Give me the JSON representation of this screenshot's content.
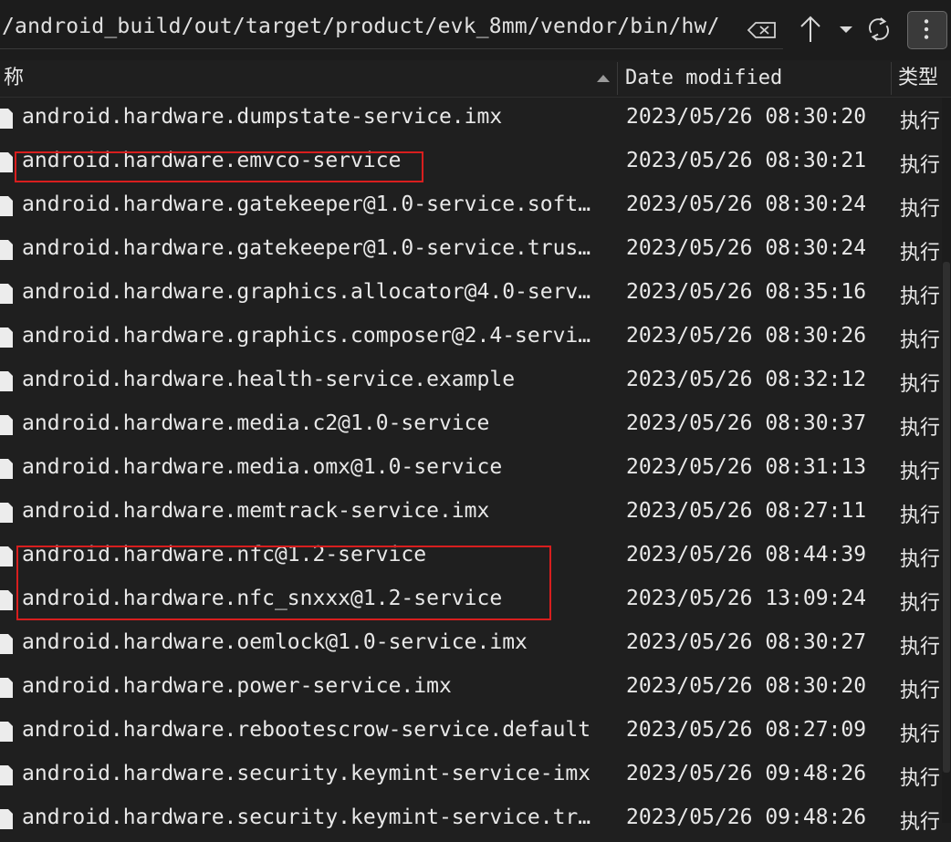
{
  "toolbar": {
    "path": "/android_build/out/target/product/evk_8mm/vendor/bin/hw/",
    "icons": [
      "backspace-icon",
      "up-arrow-icon",
      "chevron-down-icon",
      "refresh-icon",
      "more-vertical-icon"
    ]
  },
  "header": {
    "name": "称",
    "date": "Date modified",
    "type": "类型"
  },
  "files": [
    {
      "name": "android.hardware.dumpstate-service.imx",
      "date": "2023/05/26 08:30:20",
      "type": "执行"
    },
    {
      "name": "android.hardware.emvco-service",
      "date": "2023/05/26 08:30:21",
      "type": "执行"
    },
    {
      "name": "android.hardware.gatekeeper@1.0-service.soft…",
      "date": "2023/05/26 08:30:24",
      "type": "执行"
    },
    {
      "name": "android.hardware.gatekeeper@1.0-service.trus…",
      "date": "2023/05/26 08:30:24",
      "type": "执行"
    },
    {
      "name": "android.hardware.graphics.allocator@4.0-serv…",
      "date": "2023/05/26 08:35:16",
      "type": "执行"
    },
    {
      "name": "android.hardware.graphics.composer@2.4-servi…",
      "date": "2023/05/26 08:30:26",
      "type": "执行"
    },
    {
      "name": "android.hardware.health-service.example",
      "date": "2023/05/26 08:32:12",
      "type": "执行"
    },
    {
      "name": "android.hardware.media.c2@1.0-service",
      "date": "2023/05/26 08:30:37",
      "type": "执行"
    },
    {
      "name": "android.hardware.media.omx@1.0-service",
      "date": "2023/05/26 08:31:13",
      "type": "执行"
    },
    {
      "name": "android.hardware.memtrack-service.imx",
      "date": "2023/05/26 08:27:11",
      "type": "执行"
    },
    {
      "name": "android.hardware.nfc@1.2-service",
      "date": "2023/05/26 08:44:39",
      "type": "执行"
    },
    {
      "name": "android.hardware.nfc_snxxx@1.2-service",
      "date": "2023/05/26 13:09:24",
      "type": "执行"
    },
    {
      "name": "android.hardware.oemlock@1.0-service.imx",
      "date": "2023/05/26 08:30:27",
      "type": "执行"
    },
    {
      "name": "android.hardware.power-service.imx",
      "date": "2023/05/26 08:30:20",
      "type": "执行"
    },
    {
      "name": "android.hardware.rebootescrow-service.default",
      "date": "2023/05/26 08:27:09",
      "type": "执行"
    },
    {
      "name": "android.hardware.security.keymint-service-imx",
      "date": "2023/05/26 09:48:26",
      "type": "执行"
    },
    {
      "name": "android.hardware.security.keymint-service.tr…",
      "date": "2023/05/26 09:48:26",
      "type": "执行"
    }
  ],
  "highlight_color": "#d81e1e"
}
